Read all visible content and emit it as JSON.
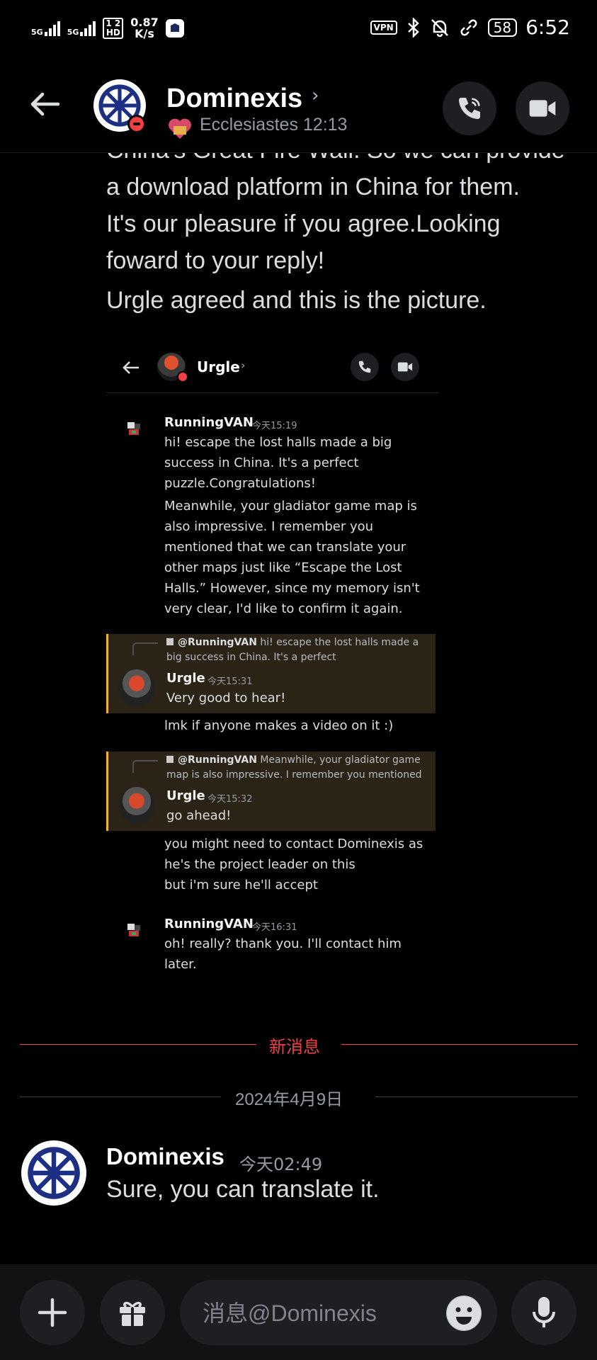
{
  "status_bar": {
    "net1": "5G",
    "net2": "5G",
    "hd_top": "1 2",
    "hd_bottom": "HD",
    "speed_value": "0.87",
    "speed_unit": "K/s",
    "vpn": "VPN",
    "battery": "58",
    "time": "6:52"
  },
  "header": {
    "title": "Dominexis",
    "chevron": "›",
    "subtitle": "Ecclesiastes 12:13"
  },
  "message_prev": {
    "lines": [
      "China's Great Fire Wall. So we can provide",
      "a download platform in China for them.",
      "It's our pleasure if you agree.Looking",
      "foward to your reply!"
    ],
    "follow_up": "Urgle agreed and this is the picture."
  },
  "embedded": {
    "title": "Urgle",
    "chevron": "›",
    "msg1": {
      "name": "RunningVAN",
      "time": "今天15:19",
      "lines": [
        "hi! escape the lost halls made a big",
        "success in China. It's a perfect",
        "puzzle.Congratulations!"
      ],
      "lines2": [
        "Meanwhile, your gladiator game map is",
        "also impressive. I remember you",
        "mentioned that we can translate your",
        "other maps just like “Escape the Lost",
        "Halls.” However, since my memory isn't",
        "very clear, I'd like to confirm it again."
      ]
    },
    "reply1": {
      "mention": "@RunningVAN",
      "quote": " hi! escape the lost halls made a",
      "quote2": "big success in China. It's a perfect",
      "name": "Urgle",
      "time": "今天15:31",
      "text": "Very good to hear!",
      "text2": "lmk if anyone makes a video on it :)"
    },
    "reply2": {
      "mention": "@RunningVAN",
      "quote": " Meanwhile, your gladiator game",
      "quote2": "map is also impressive. I remember you mentioned",
      "name": "Urgle",
      "time": "今天15:32",
      "text": "go ahead!",
      "text2": "you might need to contact Dominexis as",
      "text3": "he's the project leader on this",
      "text4": "but i'm sure he'll accept"
    },
    "msg2": {
      "name": "RunningVAN",
      "time": "今天16:31",
      "text": "oh! really? thank you. I'll contact him",
      "text2": "later."
    }
  },
  "new_messages_label": "新消息",
  "date_divider": "2024年4月9日",
  "message_last": {
    "name": "Dominexis",
    "time": "今天02:49",
    "text": "Sure, you can translate it."
  },
  "input": {
    "placeholder": "消息@Dominexis"
  },
  "colors": {
    "background": "#000000",
    "new_messages": "#f23f43",
    "reply_highlight": "#2b2416",
    "reply_border": "#f0b232",
    "dnd": "#f23f43"
  }
}
